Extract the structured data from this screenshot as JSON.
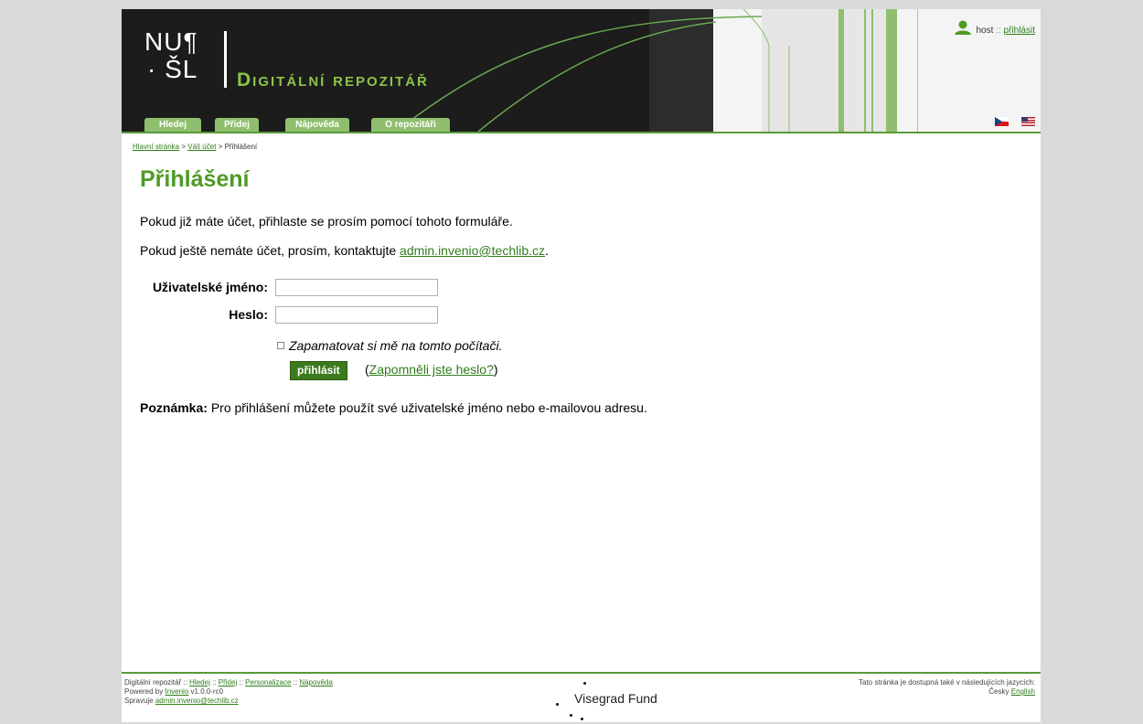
{
  "header": {
    "logo_line1": "NU¶",
    "logo_line2": "· ŠL",
    "site_title": "Digitální repozitář",
    "tabs": [
      {
        "label": "Hledej"
      },
      {
        "label": "Přidej"
      },
      {
        "label": "Nápověda"
      },
      {
        "label": "O repozitáři"
      }
    ],
    "user": {
      "name": "host",
      "separator": "::",
      "login_link": "přihlásit",
      "icon": "user-icon"
    },
    "languages": [
      {
        "icon": "czech-flag-icon"
      },
      {
        "icon": "us-flag-icon"
      }
    ]
  },
  "breadcrumb": {
    "home": "Hlavní stránka",
    "sep1": ">",
    "account": "Váš účet",
    "sep2": ">",
    "current": "Přihlášení"
  },
  "main": {
    "title": "Přihlášení",
    "intro": "Pokud již máte účet, přihlaste se prosím pomocí tohoto formuláře.",
    "contact_prefix": "Pokud ještě nemáte účet, prosím, kontaktujte",
    "contact_email": "admin.invenio@techlib.cz",
    "contact_suffix": ".",
    "form": {
      "username_label": "Uživatelské jméno:",
      "username_value": "",
      "password_label": "Heslo:",
      "password_value": "",
      "remember_label": "Zapamatovat si mě na tomto počítači.",
      "login_button": "přihlásit",
      "forgot_open": "(",
      "forgot_link": "Zapomněli jste heslo?",
      "forgot_close": ")"
    },
    "note_label": "Poznámka:",
    "note_text": "Pro přihlášení můžete použít své uživatelské jméno nebo e-mailovou adresu."
  },
  "footer": {
    "left": {
      "site": "Digitální repozitář",
      "sep": "::",
      "links": [
        "Hledej",
        "Přidej",
        "Personalizace",
        "Nápověda"
      ],
      "powered_by": "Powered by",
      "invenio": "Invenio",
      "version": "v1.0.0-rc0",
      "maintained_by": "Spravuje",
      "maintainer_email": "admin.invenio@techlib.cz"
    },
    "center": {
      "sponsor": "Visegrad Fund"
    },
    "right": {
      "languages_text": "Tato stránka je dostupná také v následujících jazycích:",
      "lang_cz": "Česky",
      "lang_en": "English"
    }
  },
  "colors": {
    "accent_green": "#4f9a25",
    "header_dark": "#1c1c1c",
    "title_green": "#8bc34a",
    "button_green": "#3c7a1e"
  }
}
